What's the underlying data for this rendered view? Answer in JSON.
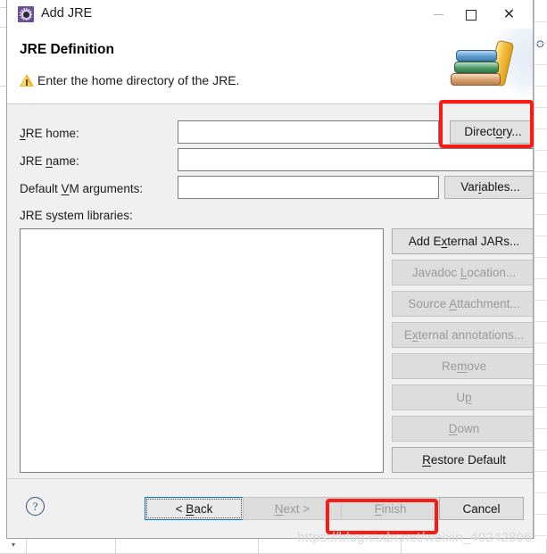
{
  "window": {
    "title": "Add JRE",
    "icon": "jre-cog-icon",
    "controls": {
      "minimize": "minimize-icon",
      "maximize": "maximize-icon",
      "close": "close-icon"
    }
  },
  "header": {
    "title": "JRE Definition",
    "message": "Enter the home directory of the JRE.",
    "status_icon": "warning-triangle-icon",
    "banner_icon": "stack-of-books-icon"
  },
  "form": {
    "jre_home": {
      "label_pre": "",
      "label_mnemonic": "J",
      "label_post": "RE home:",
      "value": "",
      "placeholder": "",
      "button": {
        "pre": "Direct",
        "mnemonic": "o",
        "post": "ry..."
      }
    },
    "jre_name": {
      "label_pre": "JRE ",
      "label_mnemonic": "n",
      "label_post": "ame:",
      "value": "",
      "placeholder": ""
    },
    "vm_args": {
      "label_pre": "Default ",
      "label_mnemonic": "V",
      "label_post": "M arguments:",
      "value": "",
      "placeholder": "",
      "button": {
        "pre": "Var",
        "mnemonic": "i",
        "post": "ables..."
      }
    },
    "system_libraries": {
      "label": "JRE system libraries:",
      "items": []
    }
  },
  "side_buttons": [
    {
      "name": "add-external-jars",
      "pre": "Add E",
      "mnemonic": "x",
      "post": "ternal JARs...",
      "disabled": false
    },
    {
      "name": "javadoc-location",
      "pre": "Javadoc ",
      "mnemonic": "L",
      "post": "ocation...",
      "disabled": true
    },
    {
      "name": "source-attachment",
      "pre": "Source ",
      "mnemonic": "A",
      "post": "ttachment...",
      "disabled": true
    },
    {
      "name": "external-annotations",
      "pre": "E",
      "mnemonic": "x",
      "post": "ternal annotations...",
      "disabled": true
    },
    {
      "name": "remove",
      "pre": "Re",
      "mnemonic": "m",
      "post": "ove",
      "disabled": true
    },
    {
      "name": "up",
      "pre": "U",
      "mnemonic": "p",
      "post": "",
      "disabled": true
    },
    {
      "name": "down",
      "pre": "",
      "mnemonic": "D",
      "post": "own",
      "disabled": true
    },
    {
      "name": "restore-default",
      "pre": "",
      "mnemonic": "R",
      "post": "estore Default",
      "disabled": false
    }
  ],
  "footer": {
    "help": "?",
    "back": {
      "pre": "< ",
      "mnemonic": "B",
      "post": "ack",
      "disabled": false,
      "focused": true
    },
    "next": {
      "pre": "",
      "mnemonic": "N",
      "post": "ext >",
      "disabled": true,
      "focused": false
    },
    "finish": {
      "pre": "",
      "mnemonic": "F",
      "post": "inish",
      "disabled": true,
      "focused": false
    },
    "cancel": {
      "pre": "Cancel",
      "mnemonic": "",
      "post": "",
      "disabled": false,
      "focused": false
    }
  },
  "annotations": {
    "highlight_color": "#fb1a14",
    "boxes": [
      "directory-button",
      "finish-button"
    ]
  },
  "watermark": "https://blog.csdn.net/weixin_40242806"
}
